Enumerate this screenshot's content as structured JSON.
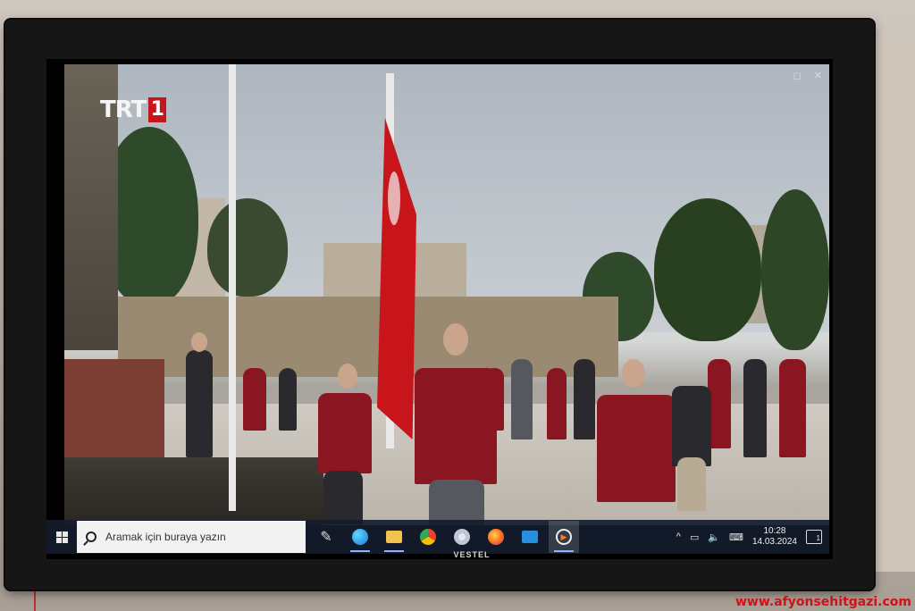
{
  "tv": {
    "brand": "VESTEL"
  },
  "video": {
    "channel_logo_text": "TRT",
    "channel_logo_number": "1",
    "window_controls": [
      "◻",
      "✕"
    ]
  },
  "taskbar": {
    "search_placeholder": "Aramak için buraya yazın",
    "pinned_apps": [
      {
        "icon": "pen-icon",
        "glyph": "✎"
      },
      {
        "icon": "edge-icon",
        "glyph": ""
      },
      {
        "icon": "file-explorer-icon",
        "glyph": ""
      },
      {
        "icon": "chrome-icon",
        "glyph": ""
      },
      {
        "icon": "paint-icon",
        "glyph": ""
      },
      {
        "icon": "firefox-icon",
        "glyph": ""
      },
      {
        "icon": "remote-desktop-icon",
        "glyph": ""
      },
      {
        "icon": "media-player-icon",
        "glyph": "▶"
      }
    ],
    "tray": {
      "chevron": "^",
      "time": "10:28",
      "date": "14.03.2024",
      "notification_count": "1"
    }
  },
  "watermark": "www.afyonsehitgazi.com",
  "colors": {
    "taskbar_bg": "#141c2c",
    "trt_red": "#c4161c",
    "watermark_red": "#d21018"
  }
}
